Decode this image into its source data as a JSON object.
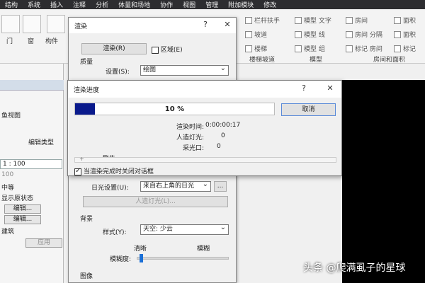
{
  "menubar": [
    "结构",
    "系统",
    "插入",
    "注释",
    "分析",
    "体量和场地",
    "协作",
    "视图",
    "管理",
    "附加模块",
    "修改"
  ],
  "ribbon": {
    "left_labels": [
      "门",
      "窗",
      "构件"
    ],
    "stair_items": [
      "栏杆扶手",
      "坡道",
      "楼梯"
    ],
    "model_items": [
      "模型 文字",
      "模型 线",
      "模型 组"
    ],
    "room_items": [
      "房间",
      "房间 分隔",
      "标记 房间"
    ],
    "area_items": [
      "面积",
      "面积",
      "标记"
    ],
    "panels": [
      "楼梯坡道",
      "模型",
      "房间和面积"
    ]
  },
  "left_panel": {
    "view_text": "鱼视图",
    "edit_type": "编辑类型",
    "scale": "1 : 100",
    "scale_value": "100",
    "detail": "中等",
    "display": "显示原状态",
    "edit1": "编辑...",
    "edit2": "编辑...",
    "discipline": "建筑",
    "apply": "应用"
  },
  "render_dialog": {
    "title": "渲染",
    "help": "?",
    "close": "✕",
    "render_button": "渲染(R)",
    "region_label": "区域(E)",
    "quality_section": "质量",
    "setting_label": "设置(S):",
    "setting_value": "绘图",
    "sun_label": "日光设置(U):",
    "sun_value": "来自右上角的日光",
    "sun_more": "...",
    "artificial_button": "人造灯光(L)...",
    "background_section": "背景",
    "style_label": "样式(Y):",
    "style_value": "天空: 少云",
    "clear_label": "清晰",
    "blur_label": "模糊",
    "haze_label": "模糊度:",
    "haze_level": 0.02,
    "image_section": "图像"
  },
  "progress_dialog": {
    "title": "渲染进度",
    "help": "?",
    "close": "✕",
    "percent_text": "10 %",
    "percent": 10,
    "cancel": "取消",
    "time_label": "渲染时间:",
    "time_value": "0:00:00:17",
    "lights_label": "人造灯光:",
    "lights_value": "0",
    "daylight_label": "采光口:",
    "daylight_value": "0",
    "warning_label": "警告:",
    "warning_toggle": "+",
    "close_on_done": "当渲染完成时关闭对话框"
  },
  "watermark": "头条 @爬满虱子的星球",
  "colors": {
    "progress_fill": "#0a1a8c",
    "viewport": "#000000",
    "menubar": "#2d2d30"
  }
}
